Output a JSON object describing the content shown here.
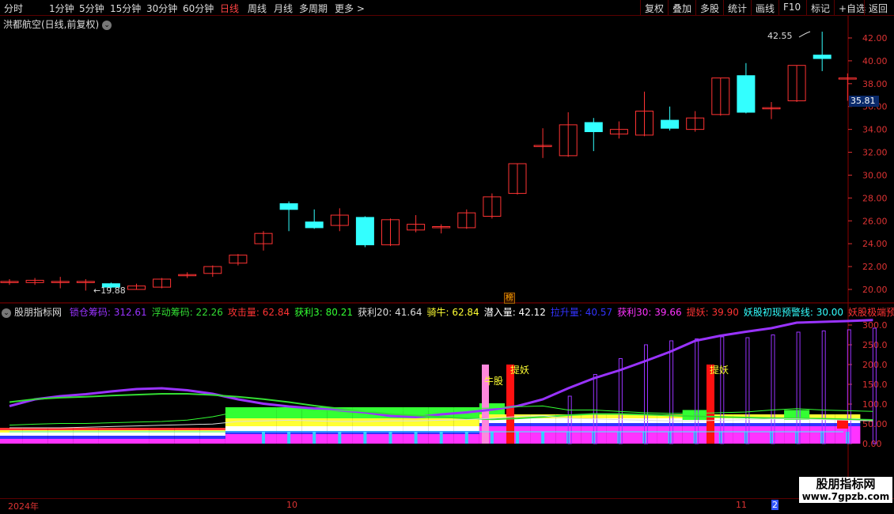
{
  "toolbar": {
    "periods": [
      "分时",
      "1分钟",
      "5分钟",
      "15分钟",
      "30分钟",
      "60分钟",
      "日线",
      "周线",
      "月线",
      "多周期",
      "更多 >"
    ],
    "active_period": "日线",
    "right_buttons": [
      "复权",
      "叠加",
      "多股",
      "统计",
      "画线",
      "F10",
      "标记",
      "+自选",
      "返回"
    ]
  },
  "chart_title": "洪都航空(日线,前复权)",
  "price_axis": [
    "42.00",
    "40.00",
    "38.00",
    "36.00",
    "34.00",
    "32.00",
    "30.00",
    "28.00",
    "26.00",
    "24.00",
    "22.00",
    "20.00"
  ],
  "current_price": "35.81",
  "high_label": "42.55",
  "low_label": "19.88",
  "bang_label": "榜",
  "indicator": {
    "name": "股朋指标网",
    "items": [
      {
        "text": "锁仓筹码: 312.61",
        "color": "#9933ff"
      },
      {
        "text": "浮动筹码: 22.26",
        "color": "#33dd33"
      },
      {
        "text": "攻击量: 62.84",
        "color": "#ff3333"
      },
      {
        "text": "获利3: 80.21",
        "color": "#33ff33"
      },
      {
        "text": "获利20: 41.64",
        "color": "#dddddd"
      },
      {
        "text": "骑牛: 62.84",
        "color": "#ffff33"
      },
      {
        "text": "潜入量: 42.12",
        "color": "#ffffff"
      },
      {
        "text": "拉升量: 40.57",
        "color": "#3333ff"
      },
      {
        "text": "获利30: 39.66",
        "color": "#ff33ff"
      },
      {
        "text": "提妖: 39.90",
        "color": "#ff3333"
      },
      {
        "text": "妖股初现预警线: 30.00",
        "color": "#33ffff"
      },
      {
        "text": "妖股极端预警线",
        "color": "#ff3333"
      }
    ],
    "axis": [
      "300.0",
      "250.0",
      "200.0",
      "150.0",
      "100.0",
      "50.00",
      "0.00"
    ],
    "annotations": {
      "niu": "牛股",
      "tiyao1": "提妖",
      "tiyao2": "提妖"
    }
  },
  "dates": [
    "2024年",
    "10",
    "11",
    "2"
  ],
  "watermark": {
    "line1": "股朋指标网",
    "line2": "www.7gpzb.com"
  },
  "colors": {
    "up": "#ff3333",
    "down": "#33ffff",
    "purple": "#9933ff",
    "green": "#33dd33"
  },
  "chart_data": {
    "type": "candlestick",
    "candles": [
      {
        "o": 20.6,
        "c": 20.7,
        "h": 20.9,
        "l": 20.4
      },
      {
        "o": 20.6,
        "c": 20.8,
        "h": 21.0,
        "l": 20.4
      },
      {
        "o": 20.6,
        "c": 20.7,
        "h": 21.1,
        "l": 20.1
      },
      {
        "o": 20.6,
        "c": 20.7,
        "h": 20.9,
        "l": 19.9
      },
      {
        "o": 20.5,
        "c": 20.2,
        "h": 20.6,
        "l": 20.1
      },
      {
        "o": 20.0,
        "c": 20.3,
        "h": 20.5,
        "l": 20.0
      },
      {
        "o": 20.2,
        "c": 20.9,
        "h": 21.0,
        "l": 20.1
      },
      {
        "o": 21.2,
        "c": 21.3,
        "h": 21.5,
        "l": 21.0
      },
      {
        "o": 21.4,
        "c": 22.0,
        "h": 22.1,
        "l": 21.1
      },
      {
        "o": 22.3,
        "c": 23.0,
        "h": 23.1,
        "l": 22.1
      },
      {
        "o": 24.0,
        "c": 24.9,
        "h": 25.1,
        "l": 23.4
      },
      {
        "o": 27.5,
        "c": 27.0,
        "h": 27.7,
        "l": 25.1
      },
      {
        "o": 25.9,
        "c": 25.4,
        "h": 27.0,
        "l": 25.3
      },
      {
        "o": 25.6,
        "c": 26.5,
        "h": 27.1,
        "l": 25.1
      },
      {
        "o": 26.3,
        "c": 23.9,
        "h": 26.4,
        "l": 23.7
      },
      {
        "o": 23.9,
        "c": 26.1,
        "h": 26.2,
        "l": 23.8
      },
      {
        "o": 25.2,
        "c": 25.7,
        "h": 26.5,
        "l": 25.0
      },
      {
        "o": 25.4,
        "c": 25.5,
        "h": 25.7,
        "l": 24.9
      },
      {
        "o": 25.4,
        "c": 26.7,
        "h": 27.0,
        "l": 25.3
      },
      {
        "o": 26.4,
        "c": 28.1,
        "h": 28.4,
        "l": 26.2
      },
      {
        "o": 28.4,
        "c": 31.0,
        "h": 31.0,
        "l": 28.3
      },
      {
        "o": 32.5,
        "c": 32.6,
        "h": 34.1,
        "l": 31.5
      },
      {
        "o": 31.7,
        "c": 34.4,
        "h": 35.5,
        "l": 31.6
      },
      {
        "o": 34.6,
        "c": 33.8,
        "h": 35.0,
        "l": 32.1
      },
      {
        "o": 33.6,
        "c": 34.0,
        "h": 34.7,
        "l": 33.2
      },
      {
        "o": 33.5,
        "c": 35.6,
        "h": 37.3,
        "l": 33.4
      },
      {
        "o": 34.8,
        "c": 34.1,
        "h": 36.0,
        "l": 33.9
      },
      {
        "o": 34.0,
        "c": 35.0,
        "h": 35.6,
        "l": 33.8
      },
      {
        "o": 35.3,
        "c": 38.5,
        "h": 38.5,
        "l": 35.2
      },
      {
        "o": 38.7,
        "c": 35.5,
        "h": 39.8,
        "l": 35.4
      },
      {
        "o": 35.8,
        "c": 35.9,
        "h": 36.4,
        "l": 34.9
      },
      {
        "o": 36.5,
        "c": 39.6,
        "h": 39.6,
        "l": 36.4
      },
      {
        "o": 40.5,
        "c": 40.2,
        "h": 42.55,
        "l": 39.1
      },
      {
        "o": 38.4,
        "c": 38.5,
        "h": 38.9,
        "l": 36.5
      }
    ],
    "ylim": [
      19.5,
      43.0
    ],
    "lock_chip_line": [
      95,
      112,
      120,
      125,
      132,
      138,
      140,
      135,
      126,
      112,
      101,
      94,
      89,
      84,
      79,
      70,
      67,
      74,
      79,
      86,
      95,
      112,
      140,
      165,
      185,
      208,
      232,
      260,
      273,
      283,
      292,
      306,
      308,
      310,
      312.61
    ],
    "purple_bars": [
      0,
      0,
      0,
      0,
      0,
      0,
      0,
      0,
      0,
      0,
      0,
      0,
      0,
      0,
      0,
      0,
      0,
      0,
      0,
      0,
      0,
      0,
      120,
      175,
      215,
      250,
      260,
      265,
      270,
      268,
      275,
      282,
      285,
      288,
      292
    ],
    "indicator_ylim": [
      -10,
      325
    ]
  }
}
